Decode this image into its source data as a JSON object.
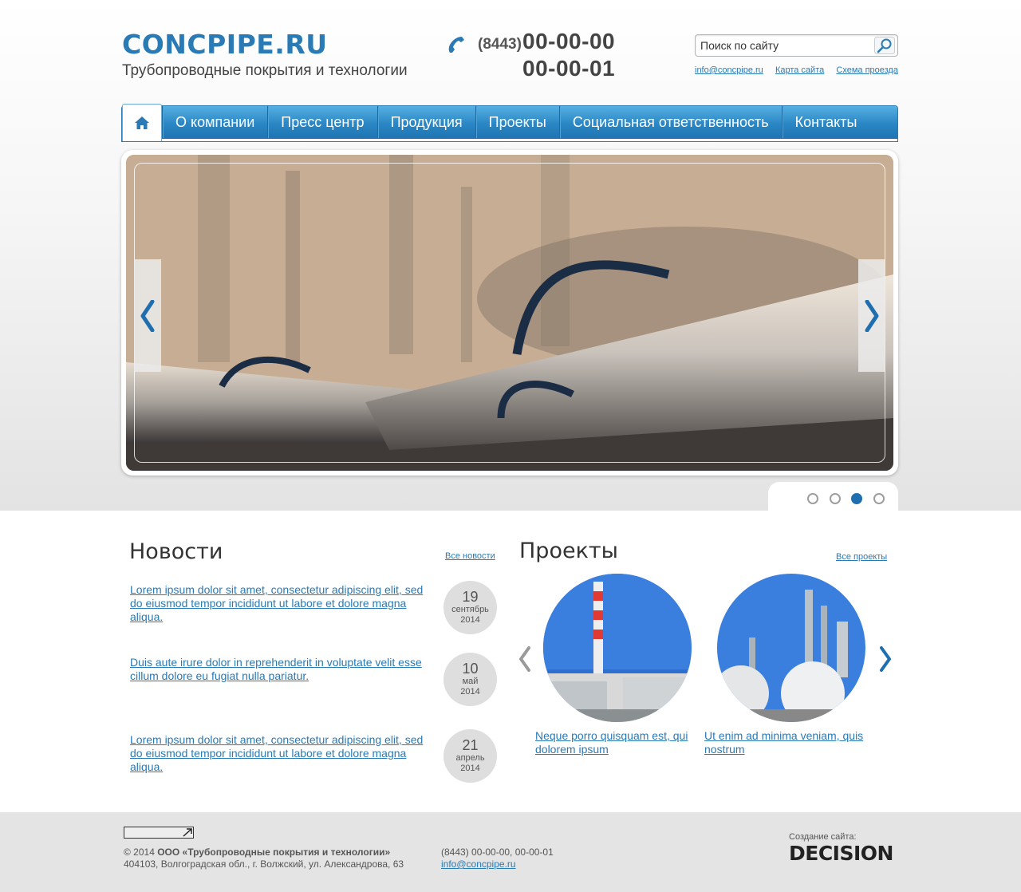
{
  "header": {
    "logo": "CONCPIPE.RU",
    "tagline": "Трубопроводные покрытия и технологии",
    "phone_code": "(8443)",
    "phone_1": "00-00-00",
    "phone_2": "00-00-01",
    "search_placeholder": "Поиск по сайту",
    "links": [
      "info@concpipe.ru",
      "Карта сайта",
      "Схема проезда"
    ]
  },
  "nav": {
    "home_icon": "home-icon",
    "items": [
      "О компании",
      "Пресс центр",
      "Продукция",
      "Проекты",
      "Социальная ответственность",
      "Контакты"
    ]
  },
  "slider": {
    "dots_count": 4,
    "active_dot": 3
  },
  "news": {
    "title": "Новости",
    "all_link": "Все новости",
    "items": [
      {
        "text": "Lorem ipsum dolor sit amet, consectetur adipiscing elit, sed do eiusmod tempor incididunt ut labore et dolore magna aliqua. ",
        "day": "19",
        "month": "сентябрь",
        "year": "2014"
      },
      {
        "text": "Duis aute irure dolor in reprehenderit in voluptate velit esse cillum dolore eu fugiat nulla pariatur. ",
        "day": "10",
        "month": "май",
        "year": "2014"
      },
      {
        "text": "Lorem ipsum dolor sit amet, consectetur adipiscing elit, sed do eiusmod tempor incididunt ut labore et dolore magna aliqua. ",
        "day": "21",
        "month": "апрель",
        "year": "2014"
      }
    ]
  },
  "projects": {
    "title": "Проекты",
    "all_link": "Все проекты",
    "items": [
      {
        "caption": "Neque porro quisquam est, qui dolorem ipsum "
      },
      {
        "caption": "Ut enim ad minima veniam, quis nostrum "
      }
    ]
  },
  "footer": {
    "copyright_prefix": "© 2014 ",
    "company": "ООО «Трубопроводные покрытия и технологии»",
    "address": "404103, Волгоградская обл., г. Волжский, ул. Александрова, 63",
    "phones": "(8443) 00-00-00, 00-00-01",
    "email": "info@concpipe.ru",
    "credit_label": "Создание сайта:",
    "credit_brand": "DECISION"
  },
  "colors": {
    "accent": "#2a7ab5",
    "nav_top": "#55b0e2",
    "nav_bottom": "#1f74b1"
  }
}
